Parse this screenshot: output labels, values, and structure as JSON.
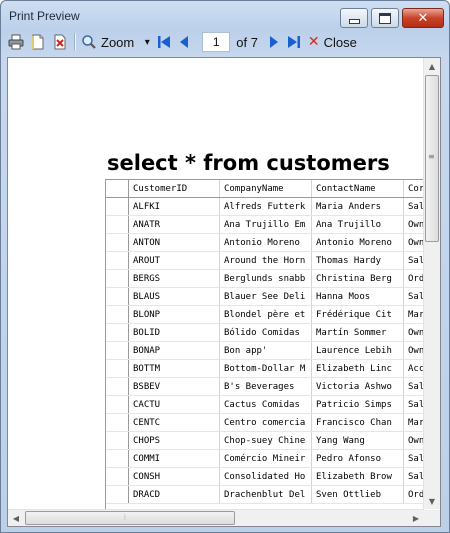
{
  "window": {
    "title": "Print Preview",
    "minimize_icon": "minimize-icon",
    "maximize_icon": "maximize-icon",
    "close_glyph": "✕"
  },
  "toolbar": {
    "print_icon": "printer-icon",
    "page_setup_icon": "page-icon",
    "pdf_icon": "pdf-export-icon",
    "zoom_label": "Zoom",
    "zoom_dropdown_glyph": "▾",
    "first_glyph": "⏮",
    "prev_glyph": "◀",
    "page_value": "1",
    "of_pages": "of 7",
    "next_glyph": "▶",
    "last_glyph": "⏭",
    "close_glyph": "✕",
    "close_label": "Close",
    "close_color": "#d42b1e",
    "nav_color": "#1a5fd0"
  },
  "report": {
    "title": "select * from customers",
    "columns": [
      "CustomerID",
      "CompanyName",
      "ContactName",
      "Cor"
    ],
    "rows": [
      [
        "ALFKI",
        "Alfreds Futterk",
        "Maria Anders",
        "Sal"
      ],
      [
        "ANATR",
        "Ana Trujillo Em",
        "Ana Trujillo",
        "Own"
      ],
      [
        "ANTON",
        "Antonio Moreno",
        "Antonio Moreno",
        "Own"
      ],
      [
        "AROUT",
        "Around the Horn",
        "Thomas Hardy",
        "Sal"
      ],
      [
        "BERGS",
        "Berglunds snabb",
        "Christina Berg",
        "Ord"
      ],
      [
        "BLAUS",
        "Blauer See Deli",
        "Hanna Moos",
        "Sal"
      ],
      [
        "BLONP",
        "Blondel père et",
        "Frédérique Cit",
        "Mar"
      ],
      [
        "BOLID",
        "Bólido Comidas",
        "Martín Sommer",
        "Own"
      ],
      [
        "BONAP",
        "Bon app'",
        "Laurence Lebih",
        "Own"
      ],
      [
        "BOTTM",
        "Bottom-Dollar M",
        "Elizabeth Linc",
        "Acc"
      ],
      [
        "BSBEV",
        "B's Beverages",
        "Victoria Ashwo",
        "Sal"
      ],
      [
        "CACTU",
        "Cactus Comidas",
        "Patricio Simps",
        "Sal"
      ],
      [
        "CENTC",
        "Centro comercia",
        "Francisco Chan",
        "Mar"
      ],
      [
        "CHOPS",
        "Chop-suey Chine",
        "Yang Wang",
        "Own"
      ],
      [
        "COMMI",
        "Comércio Mineir",
        "Pedro Afonso",
        "Sal"
      ],
      [
        "CONSH",
        "Consolidated Ho",
        "Elizabeth Brow",
        "Sal"
      ],
      [
        "DRACD",
        "Drachenblut Del",
        "Sven Ottlieb",
        "Ord"
      ]
    ]
  },
  "scrollbars": {
    "up_glyph": "▲",
    "down_glyph": "▼",
    "left_glyph": "◀",
    "right_glyph": "▶",
    "grip_glyph": "≡",
    "hgrip_glyph": "⦙"
  }
}
